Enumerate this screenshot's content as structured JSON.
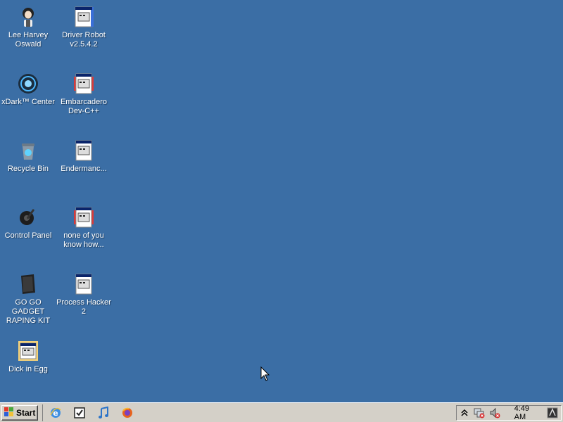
{
  "desktop": {
    "background": "#3b6ea5",
    "icons": [
      {
        "label": "Lee Harvey\nOswald",
        "icon": "user-avatar-icon"
      },
      {
        "label": "Driver Robot\nv2.5.4.2",
        "icon": "application-icon"
      },
      {
        "label": "xDark™ Center",
        "icon": "xdark-center-icon"
      },
      {
        "label": "Embarcadero\nDev-C++",
        "icon": "application-icon"
      },
      {
        "label": "Recycle Bin",
        "icon": "recycle-bin-icon"
      },
      {
        "label": "Endermanc...",
        "icon": "application-icon"
      },
      {
        "label": "Control Panel",
        "icon": "control-panel-icon"
      },
      {
        "label": "none of you\nknow how...",
        "icon": "application-icon"
      },
      {
        "label": "GO GO GADGET\nRAPING KIT",
        "icon": "black-folder-icon"
      },
      {
        "label": "Process Hacker\n2",
        "icon": "application-icon"
      },
      {
        "label": "Dick in Egg",
        "icon": "application-icon"
      }
    ]
  },
  "taskbar": {
    "start_label": "Start",
    "quick_launch": [
      {
        "icon": "internet-explorer-icon"
      },
      {
        "icon": "checkbox-app-icon"
      },
      {
        "icon": "music-note-icon"
      },
      {
        "icon": "firefox-icon"
      }
    ],
    "tray": {
      "show_hidden_icon": "chevron-up-icon",
      "network_icon": "network-disconnected-icon",
      "volume_icon": "volume-muted-icon",
      "clock": "4:49 AM",
      "end_icon": "app-tray-icon"
    }
  }
}
